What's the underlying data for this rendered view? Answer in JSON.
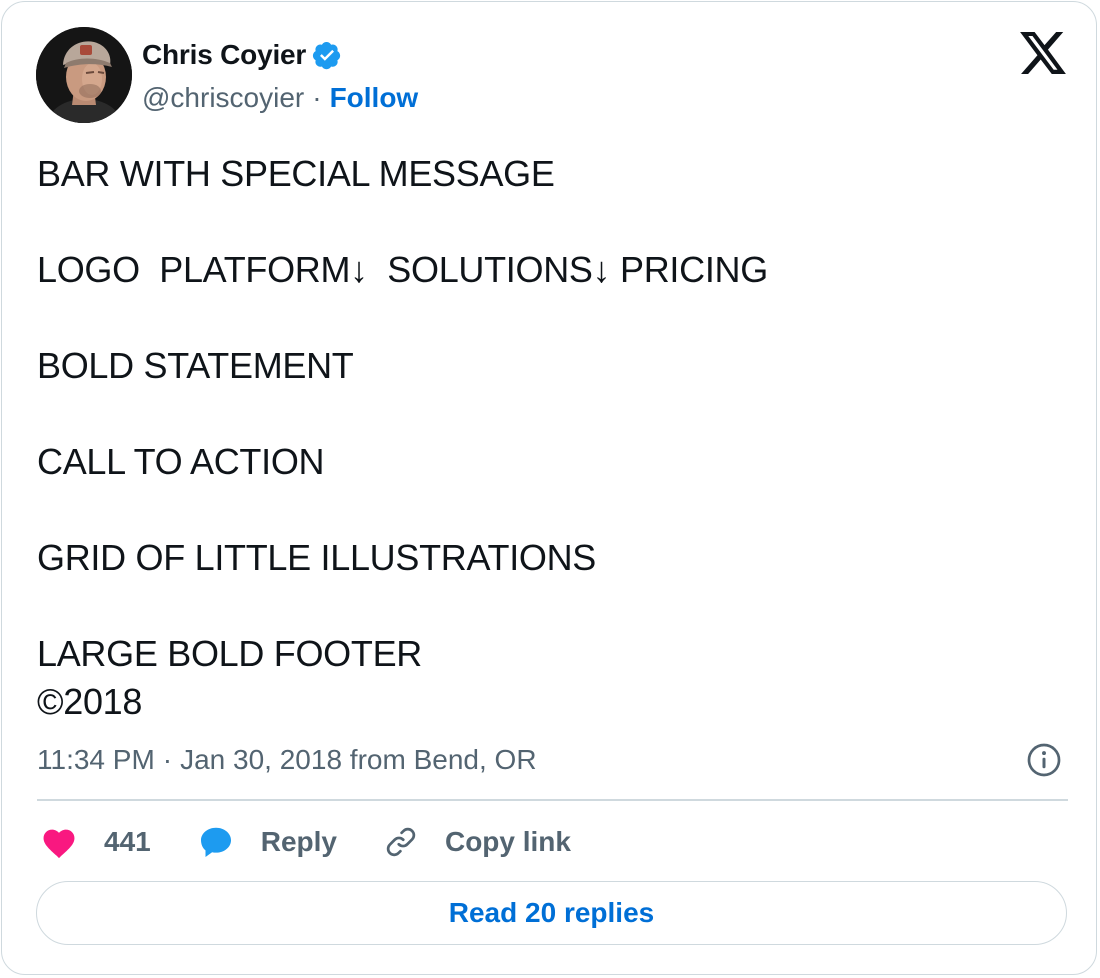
{
  "author": {
    "name": "Chris Coyier",
    "handle": "@chriscoyier",
    "separator": "·",
    "follow_label": "Follow",
    "verified": true
  },
  "tweet": {
    "lines": [
      "BAR WITH SPECIAL MESSAGE",
      "",
      "LOGO  PLATFORM↓  SOLUTIONS↓ PRICING",
      "",
      "BOLD STATEMENT",
      "",
      "CALL TO ACTION",
      "",
      "GRID OF LITTLE ILLUSTRATIONS",
      "",
      "LARGE BOLD FOOTER",
      "©2018"
    ]
  },
  "meta": {
    "time": "11:34 PM",
    "separator": "·",
    "date_location": "Jan 30, 2018 from Bend, OR"
  },
  "actions": {
    "like_count": "441",
    "reply_label": "Reply",
    "copy_link_label": "Copy link"
  },
  "read_replies_label": "Read 20 replies",
  "icons": {
    "platform_logo": "x-logo-icon",
    "verified": "verified-badge-icon",
    "info": "info-icon",
    "like": "heart-icon",
    "reply": "speech-bubble-icon",
    "copy": "link-icon"
  },
  "colors": {
    "accent": "#006fd6",
    "verified": "#1d9bf0",
    "like": "#f91880",
    "text": "#0f1419",
    "muted": "#536471",
    "border": "#cfd9de"
  }
}
